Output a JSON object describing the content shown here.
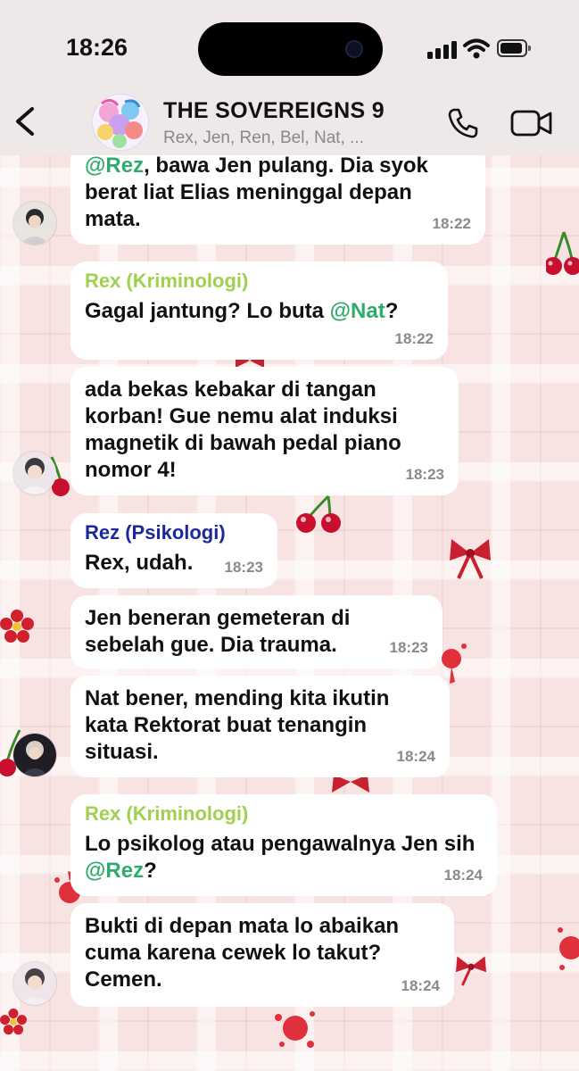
{
  "status_bar": {
    "time": "18:26"
  },
  "chat": {
    "title": "THE SOVEREIGNS 9",
    "members": "Rex, Jen, Ren, Bel, Nat, ..."
  },
  "messages": [
    {
      "parts": [
        {
          "mention": "@Rez"
        },
        {
          "text": ", bawa Jen pulang. Dia syok berat liat Elias meninggal depan mata."
        }
      ],
      "time": "18:22"
    },
    {
      "sender": "Rex (Kriminologi)",
      "parts": [
        {
          "text": "Gagal jantung? Lo buta "
        },
        {
          "mention": "@Nat"
        },
        {
          "text": "?"
        }
      ],
      "time": "18:22"
    },
    {
      "parts": [
        {
          "text": "ada bekas kebakar di tangan korban! Gue nemu alat induksi magnetik di bawah pedal piano nomor 4!"
        }
      ],
      "time": "18:23"
    },
    {
      "sender": "Rez (Psikologi)",
      "parts": [
        {
          "text": "Rex, udah."
        }
      ],
      "time": "18:23"
    },
    {
      "parts": [
        {
          "text": "Jen beneran gemeteran di sebelah gue. Dia trauma."
        }
      ],
      "time": "18:23"
    },
    {
      "parts": [
        {
          "text": "Nat bener, mending kita ikutin kata Rektorat buat tenangin situasi."
        }
      ],
      "time": "18:24"
    },
    {
      "sender": "Rex (Kriminologi)",
      "parts": [
        {
          "text": "Lo psikolog atau pengawalnya Jen sih "
        },
        {
          "mention": "@Rez"
        },
        {
          "text": "?"
        }
      ],
      "time": "18:24"
    },
    {
      "parts": [
        {
          "text": "Bukti di depan mata lo abaikan cuma karena cewek lo takut? Cemen."
        }
      ],
      "time": "18:24"
    }
  ],
  "colors": {
    "sender_rex": "#9fd04e",
    "sender_rez": "#1c2a99",
    "mention": "#2fab6b",
    "bubble": "#ffffff",
    "timestamp": "#8a8a8a"
  },
  "icons": [
    "back-chevron-icon",
    "phone-icon",
    "video-camera-icon",
    "signal-icon",
    "wifi-icon",
    "battery-icon"
  ]
}
